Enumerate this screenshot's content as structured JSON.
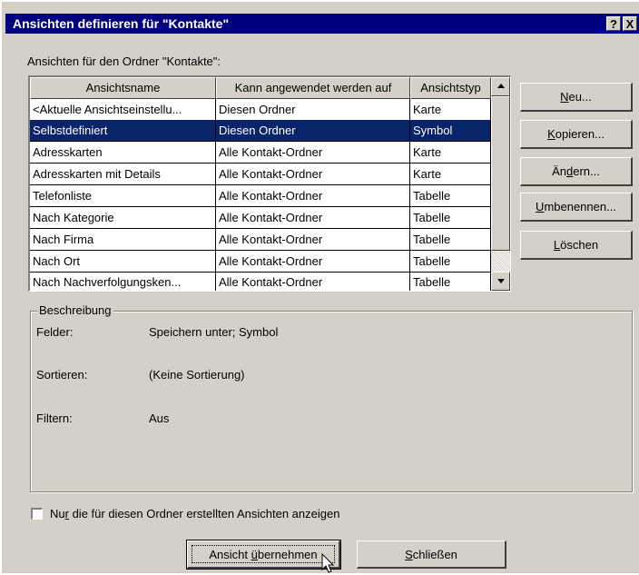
{
  "window": {
    "title": "Ansichten definieren für \"Kontakte\"",
    "help_button": "?",
    "close_button": "X"
  },
  "views_label": "Ansichten für den Ordner \"Kontakte\":",
  "table": {
    "columns": [
      "Ansichtsname",
      "Kann angewendet werden auf",
      "Ansichtstyp"
    ],
    "rows": [
      [
        "<Aktuelle Ansichtseinstellu...",
        "Diesen Ordner",
        "Karte"
      ],
      [
        "Selbstdefiniert",
        "Diesen Ordner",
        "Symbol"
      ],
      [
        "Adresskarten",
        "Alle Kontakt-Ordner",
        "Karte"
      ],
      [
        "Adresskarten mit Details",
        "Alle Kontakt-Ordner",
        "Karte"
      ],
      [
        "Telefonliste",
        "Alle Kontakt-Ordner",
        "Tabelle"
      ],
      [
        "Nach Kategorie",
        "Alle Kontakt-Ordner",
        "Tabelle"
      ],
      [
        "Nach Firma",
        "Alle Kontakt-Ordner",
        "Tabelle"
      ],
      [
        "Nach Ort",
        "Alle Kontakt-Ordner",
        "Tabelle"
      ],
      [
        "Nach Nachverfolgungsken...",
        "Alle Kontakt-Ordner",
        "Tabelle"
      ]
    ],
    "selected_row": 1
  },
  "buttons": {
    "new": {
      "pre": "",
      "key": "N",
      "post": "eu..."
    },
    "copy": {
      "pre": "",
      "key": "K",
      "post": "opieren..."
    },
    "modify": {
      "pre": "Än",
      "key": "d",
      "post": "ern..."
    },
    "rename": {
      "pre": "",
      "key": "U",
      "post": "mbenennen..."
    },
    "delete": {
      "pre": "",
      "key": "L",
      "post": "öschen"
    }
  },
  "description": {
    "legend": "Beschreibung",
    "fields_label": "Felder:",
    "fields_value": "Speichern unter; Symbol",
    "sort_label": "Sortieren:",
    "sort_value": "(Keine Sortierung)",
    "filter_label": "Filtern:",
    "filter_value": "Aus"
  },
  "checkbox": {
    "pre": "Nu",
    "key": "r",
    "post": " die für diesen Ordner erstellten Ansichten anzeigen",
    "checked": false
  },
  "apply_button": {
    "pre": "Ansicht ",
    "key": "ü",
    "post": "bernehmen"
  },
  "close_button": {
    "pre": "",
    "key": "S",
    "post": "chließen"
  },
  "colors": {
    "title_bar": "#000080",
    "selection": "#0a246a",
    "face": "#d4d0c8"
  }
}
